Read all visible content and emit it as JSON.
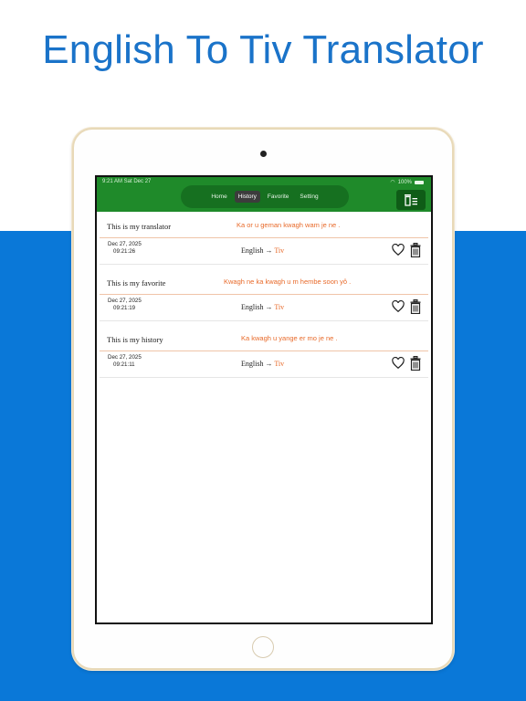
{
  "headline": "English To Tiv Translator",
  "status_bar": {
    "time": "9:21 AM  Sat Dec 27",
    "battery": "100%"
  },
  "tabs": [
    {
      "label": "Home"
    },
    {
      "label": "History",
      "active": true
    },
    {
      "label": "Favorite"
    },
    {
      "label": "Setting"
    }
  ],
  "history": [
    {
      "source": "This is my translator",
      "translation": "Ka or u geman kwagh wam je ne .",
      "date": "Dec 27, 2025",
      "time": "09:21:26",
      "from_lang": "English",
      "arrow": "→",
      "to_lang": "Tiv"
    },
    {
      "source": "This is my favorite",
      "translation": "Kwagh ne ka kwagh u m hembe soon yô .",
      "date": "Dec 27, 2025",
      "time": "09:21:19",
      "from_lang": "English",
      "arrow": "→",
      "to_lang": "Tiv"
    },
    {
      "source": "This is my history",
      "translation": "Ka kwagh u yange er mo je ne .",
      "date": "Dec 27, 2025",
      "time": "09:21:11",
      "from_lang": "English",
      "arrow": "→",
      "to_lang": "Tiv"
    }
  ],
  "colors": {
    "accent_green": "#1f8a2a",
    "accent_blue": "#0a78d8",
    "accent_orange": "#e86a2a"
  },
  "icons": {
    "clear_all": "trash-list-icon",
    "favorite": "heart-icon",
    "delete": "trash-icon"
  }
}
